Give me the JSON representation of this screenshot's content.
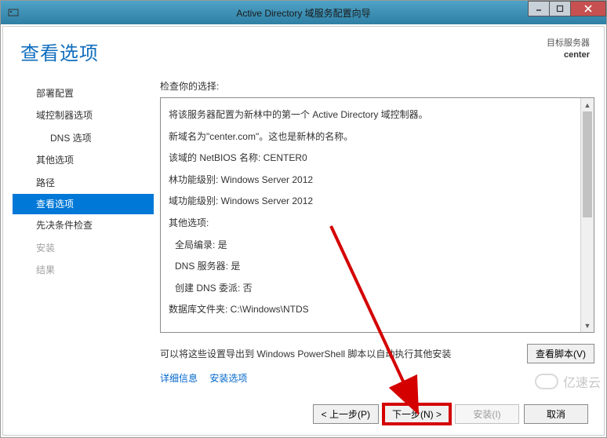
{
  "window": {
    "title": "Active Directory 域服务配置向导"
  },
  "header": {
    "page_title": "查看选项",
    "target_label": "目标服务器",
    "target_value": "center"
  },
  "sidebar": {
    "items": [
      {
        "label": "部署配置",
        "indent": false
      },
      {
        "label": "域控制器选项",
        "indent": false
      },
      {
        "label": "DNS 选项",
        "indent": true
      },
      {
        "label": "其他选项",
        "indent": false
      },
      {
        "label": "路径",
        "indent": false
      },
      {
        "label": "查看选项",
        "indent": false,
        "selected": true
      },
      {
        "label": "先决条件检查",
        "indent": false
      },
      {
        "label": "安装",
        "indent": false,
        "disabled": true
      },
      {
        "label": "结果",
        "indent": false,
        "disabled": true
      }
    ]
  },
  "content": {
    "prompt": "检查你的选择:",
    "lines": {
      "l0": "将该服务器配置为新林中的第一个 Active Directory 域控制器。",
      "l1": "新域名为\"center.com\"。这也是新林的名称。",
      "l2": "该域的 NetBIOS 名称: CENTER0",
      "l3": "林功能级别: Windows Server 2012",
      "l4": "域功能级别: Windows Server 2012",
      "l5": "其他选项:",
      "l6": "全局编录: 是",
      "l7": "DNS 服务器: 是",
      "l8": "创建 DNS 委派: 否",
      "l9": "数据库文件夹: C:\\Windows\\NTDS"
    },
    "export_text": "可以将这些设置导出到 Windows PowerShell 脚本以自动执行其他安装",
    "view_script_btn": "查看脚本(V)",
    "link_more_info": "详细信息",
    "link_install_opts": "安装选项"
  },
  "footer": {
    "prev": "< 上一步(P)",
    "next": "下一步(N) >",
    "install": "安装(I)",
    "cancel": "取消"
  },
  "watermark": {
    "text": "亿速云"
  }
}
